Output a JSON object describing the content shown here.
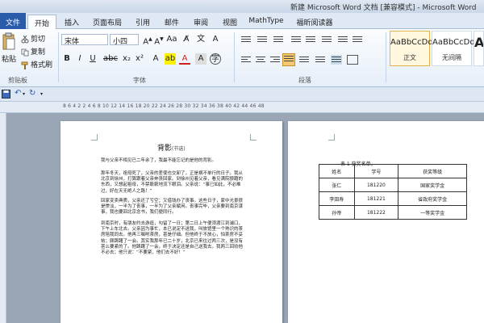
{
  "window": {
    "title": "新建 Microsoft Word 文档 [兼容模式] - Microsoft Word"
  },
  "tabs": [
    "文件",
    "开始",
    "插入",
    "页面布局",
    "引用",
    "邮件",
    "审阅",
    "视图",
    "MathType",
    "福昕阅读器"
  ],
  "clipboard": {
    "paste": "粘贴",
    "cut": "剪切",
    "copy": "复制",
    "painter": "格式刷",
    "label": "剪贴板"
  },
  "font": {
    "name": "宋体",
    "size": "小四",
    "label": "字体",
    "bold": "B",
    "italic": "I",
    "underline": "U"
  },
  "paragraph": {
    "label": "段落"
  },
  "styles": [
    {
      "sample": "AaBbCcDd",
      "name": "正文"
    },
    {
      "sample": "AaBbCcDd",
      "name": "无间隔"
    },
    {
      "sample": "A",
      "name": ""
    }
  ],
  "ruler": {
    "scale": "8  6  4  2     2  4  6  8  10  12  14  16  18  20  22  24  26  28  30  32  34  36  38  40  42  44  46  48"
  },
  "page1": {
    "title": "背影",
    "title_note": "(节选)",
    "paragraphs": [
      "我与父亲不相见已二年余了，我最不能忘记的是他的背影。",
      "那年冬天，祖母死了，父亲的差使也交卸了，正是祸不单行的日子。我从北京到徐州，打算跟着父亲奔丧回家。到徐州见着父亲，看见满院狼藉的东西，又想起祖母，不禁簌簌地流下眼泪。父亲说：“事已如此，不必难过，好在天无绝人之路！”",
      "回家变卖典质，父亲还了亏空；又借钱办了丧事。这些日子，家中光景很是惨淡，一半为了丧事，一半为了父亲赋闲。丧事完毕，父亲要到南京谋事，我也要回北京念书，我们便同行。",
      "到南京时，有朋友约去游逛，勾留了一日；第二日上午便须渡江到浦口，下午上车北去。父亲因为事忙，本已说定不送我，叫旅馆里一个熟识的茶房陪我同去。他再三嘱咐茶房，甚是仔细。但他终于不放心，怕茶房不妥帖；颇踌躇了一会。其实我那年已二十岁，北京已来往过两三次，是没有甚么要紧的了。他踌躇了一会，终于决定还是自己送我去。我两三回劝他不必去；他只说：“不要紧，他们去不好！”"
    ]
  },
  "page2": {
    "caption": "表 1 获奖名单。",
    "headers": [
      "姓名",
      "学号",
      "获奖等级"
    ],
    "rows": [
      [
        "张仁",
        "181220",
        "国家奖学金"
      ],
      [
        "李田寿",
        "181221",
        "省政府奖学金"
      ],
      [
        "孙帝",
        "181222",
        "一等奖学金"
      ]
    ]
  }
}
